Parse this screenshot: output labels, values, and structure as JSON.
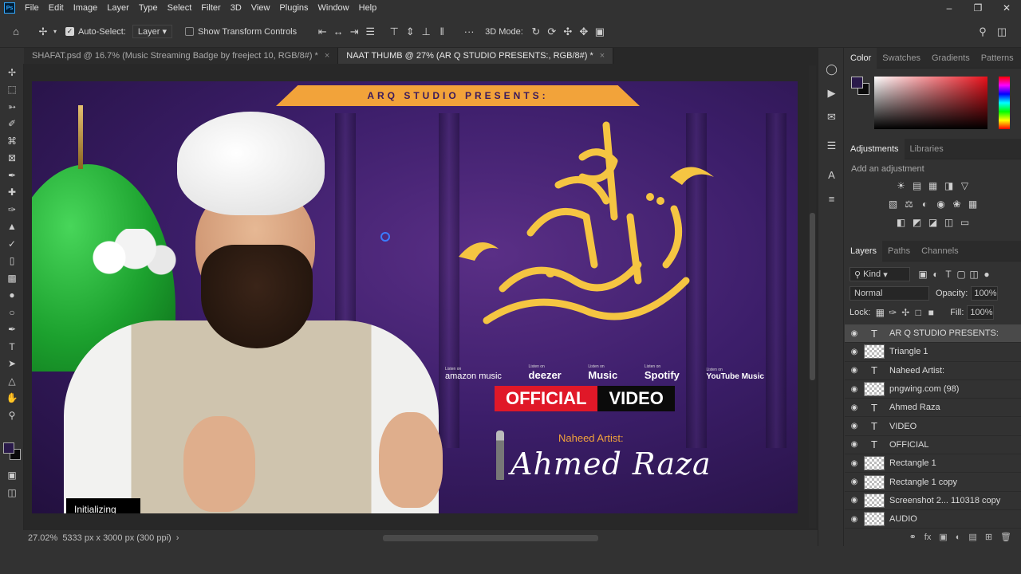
{
  "menu": [
    "File",
    "Edit",
    "Image",
    "Layer",
    "Type",
    "Select",
    "Filter",
    "3D",
    "View",
    "Plugins",
    "Window",
    "Help"
  ],
  "options": {
    "auto_select_label": "Auto-Select:",
    "auto_select_value": "Layer",
    "show_transform": "Show Transform Controls",
    "mode_3d": "3D Mode:",
    "more": "···"
  },
  "tabs": [
    {
      "label": "SHAFAT.psd @ 16.7% (Music Streaming Badge by freeject 10, RGB/8#) *",
      "active": false
    },
    {
      "label": "NAAT THUMB @ 27% (AR Q STUDIO PRESENTS:, RGB/8#) *",
      "active": true
    }
  ],
  "artwork": {
    "banner": "ARQ STUDIO PRESENTS:",
    "services": [
      {
        "top": "Listen on",
        "name": "amazon music"
      },
      {
        "top": "Listen on",
        "name": "deezer"
      },
      {
        "top": "Listen on",
        "name": "Music"
      },
      {
        "top": "Listen on",
        "name": "Spotify"
      },
      {
        "top": "Listen on",
        "name": "YouTube Music"
      }
    ],
    "official": "OFFICIAL",
    "video": "VIDEO",
    "artist_label": "Naheed Artist:",
    "artist_name": "Ahmed Raza",
    "init_badge": "Initializing"
  },
  "status": {
    "zoom": "27.02%",
    "doc_info": "5333 px x 3000 px (300 ppi)"
  },
  "panels": {
    "color_tabs": [
      "Color",
      "Swatches",
      "Gradients",
      "Patterns"
    ],
    "adj_tabs": [
      "Adjustments",
      "Libraries"
    ],
    "adj_hint": "Add an adjustment",
    "layers_tabs": [
      "Layers",
      "Paths",
      "Channels"
    ],
    "kind": "Kind",
    "blend": "Normal",
    "opacity_label": "Opacity:",
    "opacity": "100%",
    "lock_label": "Lock:",
    "fill_label": "Fill:",
    "fill": "100%"
  },
  "layers": [
    {
      "name": "AR Q STUDIO PRESENTS:",
      "type": "text",
      "selected": true
    },
    {
      "name": "Triangle 1",
      "type": "image",
      "selected": false
    },
    {
      "name": "Naheed Artist:",
      "type": "text",
      "selected": false
    },
    {
      "name": "pngwing.com (98)",
      "type": "image",
      "selected": false
    },
    {
      "name": "Ahmed Raza",
      "type": "text",
      "selected": false
    },
    {
      "name": "VIDEO",
      "type": "text",
      "selected": false
    },
    {
      "name": "OFFICIAL",
      "type": "text",
      "selected": false
    },
    {
      "name": "Rectangle 1",
      "type": "image",
      "selected": false
    },
    {
      "name": "Rectangle 1 copy",
      "type": "image",
      "selected": false
    },
    {
      "name": "Screenshot 2... 110318 copy",
      "type": "image",
      "selected": false
    },
    {
      "name": "AUDIO",
      "type": "image",
      "selected": false
    }
  ]
}
